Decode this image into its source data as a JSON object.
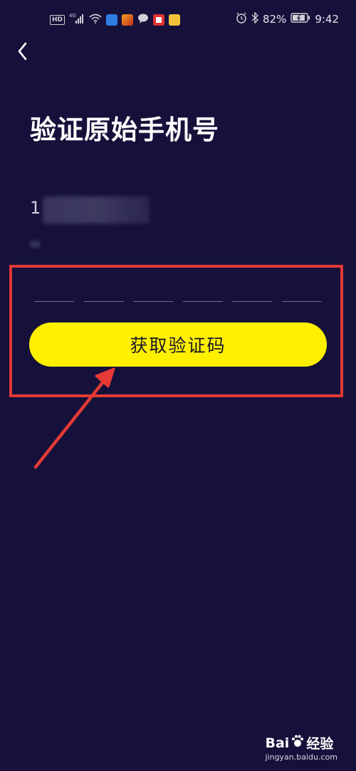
{
  "status_bar": {
    "hd_label": "HD",
    "network_label": "4G",
    "battery_percent": "82%",
    "time": "9:42",
    "icons": [
      "hd-icon",
      "signal-icon",
      "wifi-icon",
      "shield-app-icon",
      "game-app-icon",
      "chat-bubble-icon",
      "browser-app-icon",
      "emoji-app-icon",
      "alarm-icon",
      "bluetooth-icon",
      "battery-icon"
    ]
  },
  "header": {
    "back_icon": "chevron-left-icon"
  },
  "main": {
    "title": "验证原始手机号",
    "phone_prefix": "1",
    "code_slot_count": 6,
    "get_code_label": "获取验证码"
  },
  "annotation": {
    "box_color": "#e53a35",
    "arrow_color": "#e53a35"
  },
  "colors": {
    "background": "#15113a",
    "button": "#fff000",
    "button_text": "#1a1626"
  },
  "watermark": {
    "brand": "Bai",
    "brand_suffix": "经验",
    "url": "jingyan.baidu.com"
  }
}
